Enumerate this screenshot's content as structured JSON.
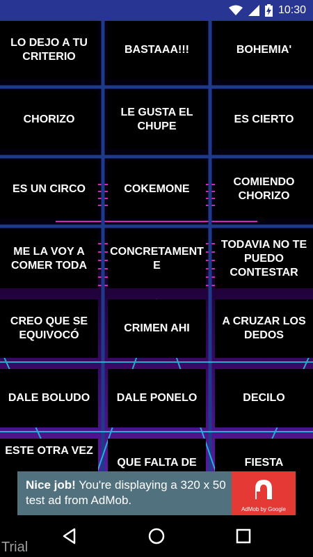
{
  "status_bar": {
    "time": "10:30",
    "icons": [
      "wifi-icon",
      "signal-icon",
      "battery-charging-icon"
    ]
  },
  "buttons": [
    "LO DEJO A TU CRITERIO",
    "BASTAAA!!!",
    "BOHEMIA'",
    "CHORIZO",
    "LE GUSTA EL CHUPE",
    "ES CIERTO",
    "ES UN CIRCO",
    "COKEMONE",
    "COMIENDO CHORIZO",
    "ME LA VOY A COMER TODA",
    "CONCRETAMENT E",
    "TODAVIA NO TE PUEDO CONTESTAR",
    "CREO QUE SE EQUIVOCÓ",
    "CRIMEN AHI",
    "A CRUZAR LOS DEDOS",
    "DALE BOLUDO",
    "DALE PONELO",
    "DECILO",
    "ESTE OTRA VEZ",
    "QUE FALTA DE",
    "FIESTA"
  ],
  "ad": {
    "headline": "Nice job!",
    "body": " You're displaying a 320 x 50 test ad from AdMob.",
    "logo_caption": "AdMob by Google"
  },
  "nav": {
    "icons": [
      "back-icon",
      "home-icon",
      "recents-icon"
    ]
  },
  "watermark": "Trial"
}
